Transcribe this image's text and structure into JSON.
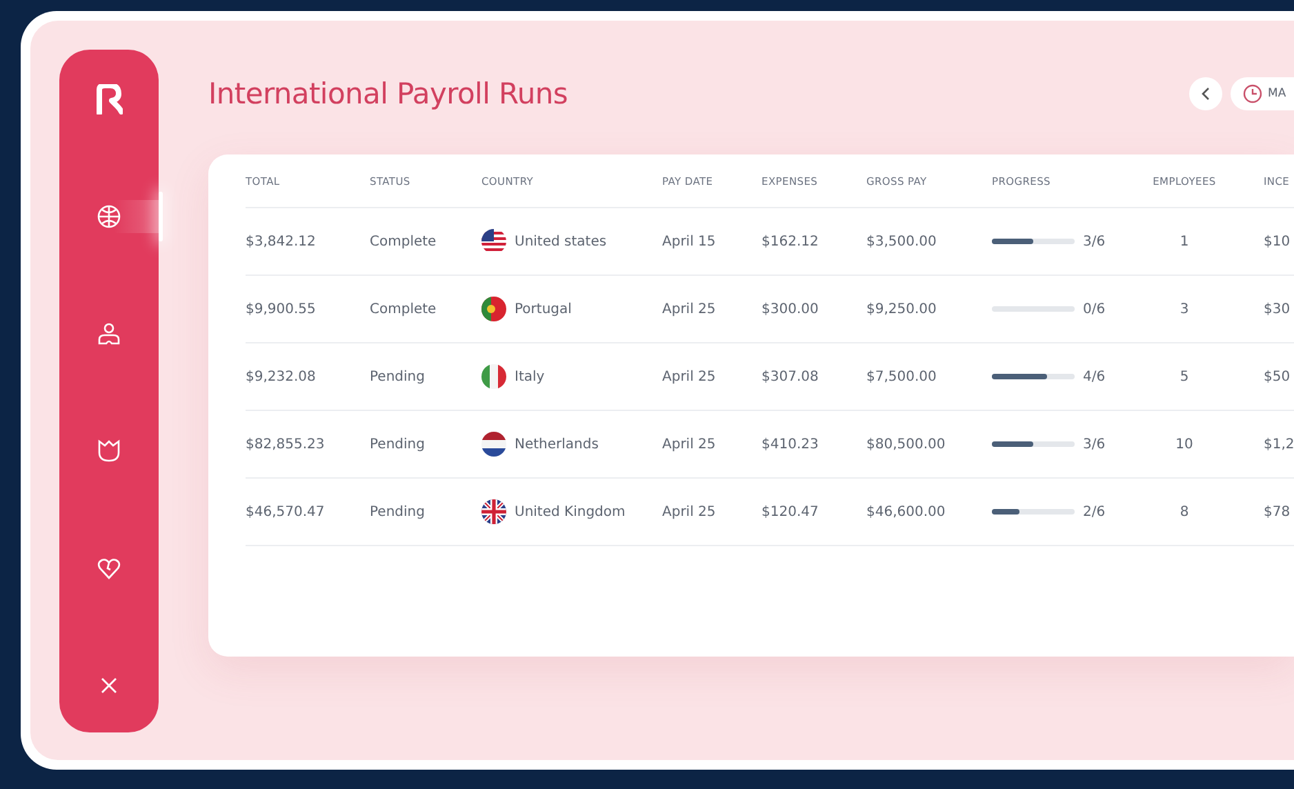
{
  "sidebar": {
    "items": [
      {
        "kind": "globe",
        "selected": true
      },
      {
        "kind": "person",
        "selected": false
      },
      {
        "kind": "crown",
        "selected": false
      },
      {
        "kind": "heart",
        "selected": false
      }
    ]
  },
  "title": "International Payroll Runs",
  "date_button": {
    "label": "MA"
  },
  "table": {
    "columns": [
      "TOTAL",
      "STATUS",
      "COUNTRY",
      "PAY DATE",
      "EXPENSES",
      "GROSS PAY",
      "PROGRESS",
      "EMPLOYEES",
      "INCE"
    ],
    "rows": [
      {
        "total": "$3,842.12",
        "status": "Complete",
        "kind": "us",
        "country": "United states",
        "pay_date": "April 15",
        "expenses": "$162.12",
        "gross_pay": "$3,500.00",
        "level": 0.5,
        "progress": "3/6",
        "employees": "1",
        "column_9": "$10"
      },
      {
        "total": "$9,900.55",
        "status": "Complete",
        "kind": "pt",
        "country": "Portugal",
        "pay_date": "April 25",
        "expenses": "$300.00",
        "gross_pay": "$9,250.00",
        "level": 0,
        "progress": "0/6",
        "employees": "3",
        "column_9": "$30"
      },
      {
        "total": "$9,232.08",
        "status": "Pending",
        "kind": "it",
        "country": "Italy",
        "pay_date": "April 25",
        "expenses": "$307.08",
        "gross_pay": "$7,500.00",
        "level": 0.667,
        "progress": "4/6",
        "employees": "5",
        "column_9": "$50"
      },
      {
        "total": "$82,855.23",
        "status": "Pending",
        "kind": "nl",
        "country": "Netherlands",
        "pay_date": "April 25",
        "expenses": "$410.23",
        "gross_pay": "$80,500.00",
        "level": 0.5,
        "progress": "3/6",
        "employees": "10",
        "column_9": "$1,2"
      },
      {
        "total": "$46,570.47",
        "status": "Pending",
        "kind": "gb",
        "country": "United Kingdom",
        "pay_date": "April 25",
        "expenses": "$120.47",
        "gross_pay": "$46,600.00",
        "level": 0.333,
        "progress": "2/6",
        "employees": "8",
        "column_9": "$78"
      }
    ]
  }
}
